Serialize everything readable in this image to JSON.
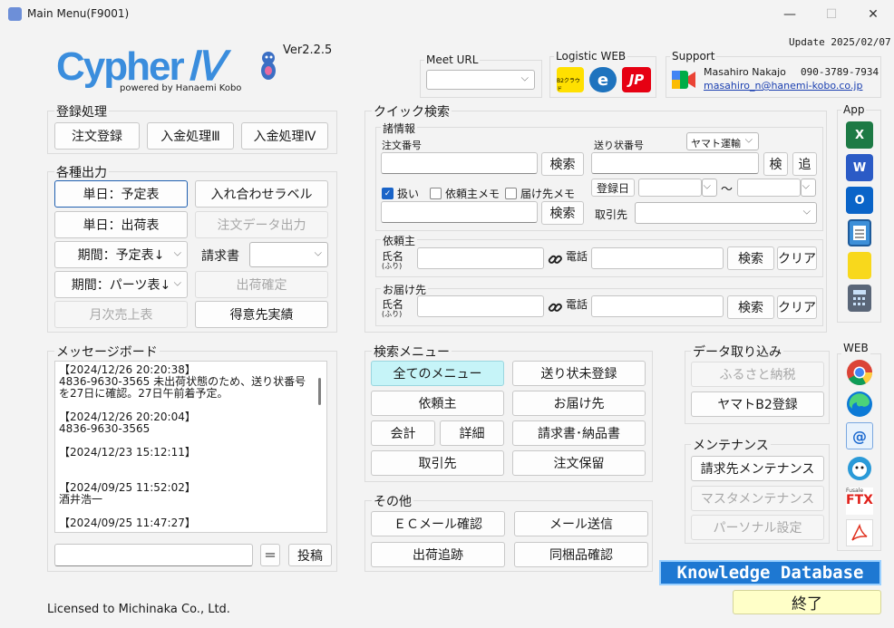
{
  "window": {
    "title": "Main Menu(F9001)",
    "minimize": "—",
    "maximize": "☐",
    "close": "✕"
  },
  "header": {
    "logo_main": "Cypher",
    "logo_roman": "Ⅳ",
    "logo_sub": "powered by Hanaemi Kobo",
    "version": "Ver2.2.5",
    "update": "Update 2025/02/07"
  },
  "meet": {
    "label": "Meet URL",
    "value": ""
  },
  "logistic": {
    "label": "Logistic WEB",
    "icons": [
      "yamato-b2-cloud-icon",
      "e-hiden-icon",
      "japan-post-web-icon"
    ],
    "icon_texts": [
      "B2クラウド",
      "e",
      "JP"
    ]
  },
  "support": {
    "label": "Support",
    "name": "Masahiro Nakajo",
    "phone": "090-3789-7934",
    "email": "masahiro_n@hanemi-kobo.co.jp"
  },
  "touroku": {
    "label": "登録処理",
    "buttons": [
      "注文登録",
      "入金処理Ⅲ",
      "入金処理Ⅳ"
    ]
  },
  "output": {
    "label": "各種出力",
    "buttons": [
      "単日：予定表",
      "入れ合わせラベル",
      "単日：出荷表",
      "注文データ出力",
      "期間：予定表↓",
      "請求書",
      "期間：パーツ表↓",
      "出荷確定",
      "月次売上表",
      "得意先実績"
    ],
    "seikyu_select": ""
  },
  "quick": {
    "label": "クイック検索",
    "info_label": "諸情報",
    "order_no_label": "注文番号",
    "search": "検索",
    "tracking_label": "送り状番号",
    "carrier": "ヤマト運輸",
    "ken": "検",
    "tsui": "追",
    "checks": [
      {
        "label": "扱い",
        "checked": true
      },
      {
        "label": "依頼主メモ",
        "checked": false
      },
      {
        "label": "届け先メモ",
        "checked": false
      }
    ],
    "reg_date": "登録日",
    "tilde": "〜",
    "client_label": "取引先",
    "requester_label": "依頼主",
    "name_label": "氏名",
    "furi": "(ふり)",
    "tel_label": "電話",
    "clear": "クリア",
    "dest_label": "お届け先"
  },
  "messages": {
    "label": "メッセージボード",
    "lines": [
      "【2024/12/26 20:20:38】",
      "4836-9630-3565 未出荷状態のため、送り状番号",
      "を27日に確認。27日午前着予定。",
      "",
      "【2024/12/26 20:20:04】",
      "4836-9630-3565",
      "",
      "【2024/12/23 15:12:11】",
      "",
      "",
      "【2024/09/25 11:52:02】",
      "酒井浩一",
      "",
      "【2024/09/25 11:47:27】"
    ],
    "equals": "＝",
    "post": "投稿"
  },
  "search_menu": {
    "label": "検索メニュー",
    "buttons": [
      "全てのメニュー",
      "送り状未登録",
      "依頼主",
      "お届け先",
      "会計",
      "詳細",
      "請求書･納品書",
      "取引先",
      "注文保留"
    ]
  },
  "other": {
    "label": "その他",
    "buttons": [
      "ＥＣメール確認",
      "メール送信",
      "出荷追跡",
      "同梱品確認"
    ]
  },
  "import": {
    "label": "データ取り込み",
    "buttons": [
      "ふるさと納税",
      "ヤマトB2登録"
    ]
  },
  "maint": {
    "label": "メンテナンス",
    "buttons": [
      "請求先メンテナンス",
      "マスタメンテナンス",
      "パーソナル設定"
    ]
  },
  "app": {
    "label": "App",
    "icons": [
      "excel-icon",
      "word-icon",
      "outlook-icon",
      "notepad-icon",
      "sticky-notes-icon",
      "calculator-icon"
    ],
    "letters": [
      "X",
      "W",
      "O",
      "",
      "",
      ""
    ]
  },
  "web": {
    "label": "WEB",
    "icons": [
      "chrome-icon",
      "edge-icon",
      "mail-icon",
      "mascot-icon",
      "fusale-ftx-icon",
      "acrobat-icon"
    ],
    "ftx_top": "Fusale",
    "ftx": "FTX"
  },
  "footer": {
    "license": "Licensed to Michinaka Co., Ltd.",
    "kb": "Knowledge Database",
    "exit": "終了"
  },
  "colors": {
    "accent": "#1f5fb0",
    "logo": "#3a8ddd",
    "cyan": "#c6f4f8",
    "yellow": "#ffffc8"
  }
}
